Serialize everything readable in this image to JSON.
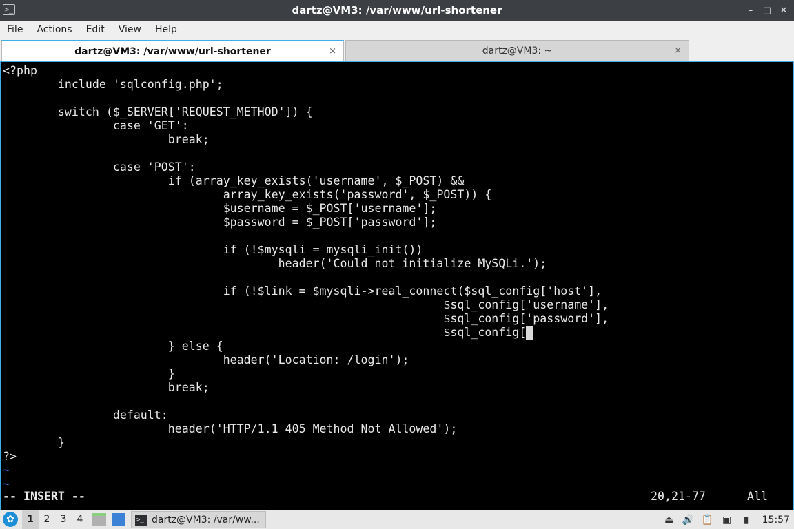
{
  "window": {
    "title": "dartz@VM3: /var/www/url-shortener",
    "app_icon_glyph": ">_",
    "icons": [
      "minimize-icon",
      "maximize-icon",
      "close-icon"
    ]
  },
  "menubar": {
    "file": "File",
    "actions": "Actions",
    "edit": "Edit",
    "view": "View",
    "help": "Help"
  },
  "tabs": [
    {
      "label": "dartz@VM3: /var/www/url-shortener",
      "active": true,
      "close": "×"
    },
    {
      "label": "dartz@VM3: ~",
      "active": false,
      "close": "×"
    }
  ],
  "editor": {
    "lines": [
      "<?php",
      "        include 'sqlconfig.php';",
      "",
      "        switch ($_SERVER['REQUEST_METHOD']) {",
      "                case 'GET':",
      "                        break;",
      "",
      "                case 'POST':",
      "                        if (array_key_exists('username', $_POST) &&",
      "                                array_key_exists('password', $_POST)) {",
      "                                $username = $_POST['username'];",
      "                                $password = $_POST['password'];",
      "",
      "                                if (!$mysqli = mysqli_init())",
      "                                        header('Could not initialize MySQLi.');",
      "",
      "                                if (!$link = $mysqli->real_connect($sql_config['host'],",
      "                                                                $sql_config['username'],",
      "                                                                $sql_config['password'],",
      "                                                                $sql_config[",
      "                        } else {",
      "                                header('Location: /login');",
      "                        }",
      "                        break;",
      "",
      "                default:",
      "                        header('HTTP/1.1 405 Method Not Allowed');",
      "        }",
      "?>"
    ],
    "empty_markers": [
      "~",
      "~"
    ],
    "mode": "-- INSERT --",
    "position": "20,21-77",
    "scroll": "All",
    "accent_color": "#3daee9",
    "tilde_color": "#3a6de0"
  },
  "taskbar": {
    "start_glyph": "✿",
    "workspaces": [
      "1",
      "2",
      "3",
      "4"
    ],
    "active_workspace": "1",
    "task_label": "dartz@VM3: /var/ww...",
    "clock": "15:57",
    "tray_icons": [
      "eject-icon",
      "volume-icon",
      "clipboard-icon",
      "network-icon",
      "battery-icon"
    ]
  }
}
